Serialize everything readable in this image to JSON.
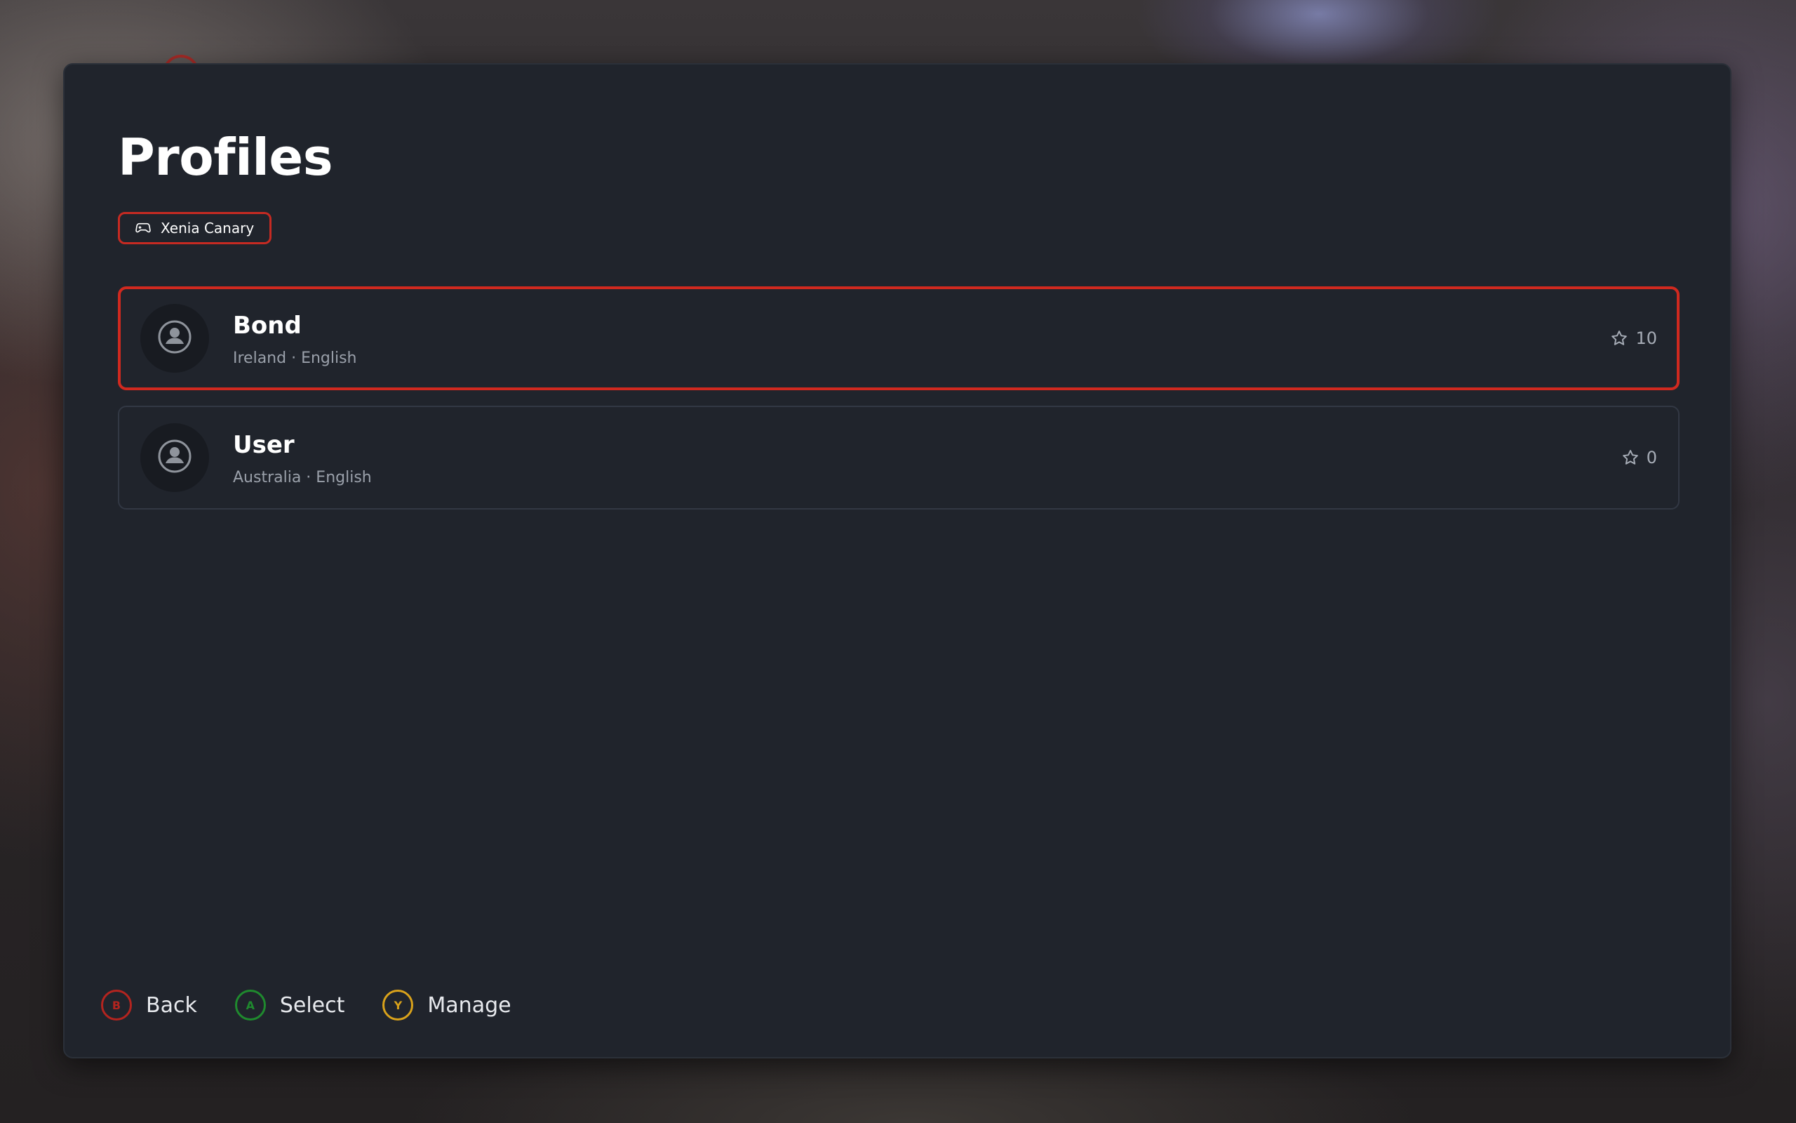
{
  "page": {
    "title": "Profiles"
  },
  "source_chip": {
    "icon": "gamepad-icon",
    "label": "Xenia Canary"
  },
  "profiles": [
    {
      "name": "Bond",
      "meta": "Ireland · English",
      "score": "10",
      "selected": true,
      "avatar_icon": "user-circle-icon",
      "score_icon": "star-icon"
    },
    {
      "name": "User",
      "meta": "Australia · English",
      "score": "0",
      "selected": false,
      "avatar_icon": "user-circle-icon",
      "score_icon": "star-icon"
    }
  ],
  "hints": [
    {
      "button": "B",
      "label": "Back",
      "color": "#b3241f"
    },
    {
      "button": "A",
      "label": "Select",
      "color": "#1f8a2e"
    },
    {
      "button": "Y",
      "label": "Manage",
      "color": "#d9a21b"
    }
  ],
  "colors": {
    "accent": "#d0291f",
    "panel": "#20242c",
    "muted_text": "#9aa0aa"
  }
}
